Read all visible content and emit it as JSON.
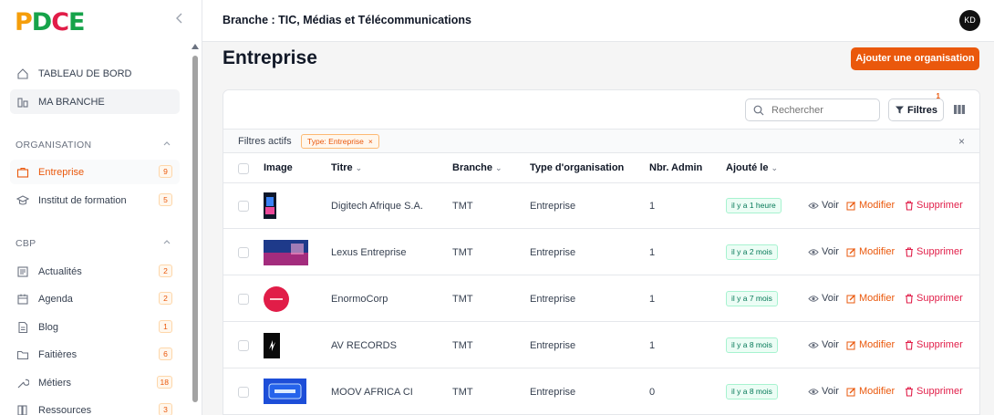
{
  "brand": {
    "logo_text": "PDCE"
  },
  "sidebar": {
    "top_items": [
      {
        "label": "TABLEAU DE BORD",
        "icon": "home-icon"
      },
      {
        "label": "MA BRANCHE",
        "icon": "branch-icon"
      }
    ],
    "sections": [
      {
        "title": "ORGANISATION",
        "items": [
          {
            "label": "Entreprise",
            "count": "9",
            "icon": "briefcase-icon"
          },
          {
            "label": "Institut de formation",
            "count": "5",
            "icon": "graduation-cap-icon"
          }
        ]
      },
      {
        "title": "CBP",
        "items": [
          {
            "label": "Actualités",
            "count": "2",
            "icon": "newspaper-icon"
          },
          {
            "label": "Agenda",
            "count": "2",
            "icon": "calendar-icon"
          },
          {
            "label": "Blog",
            "count": "1",
            "icon": "document-icon"
          },
          {
            "label": "Faitières",
            "count": "6",
            "icon": "folder-icon"
          },
          {
            "label": "Métiers",
            "count": "18",
            "icon": "tools-icon"
          },
          {
            "label": "Ressources",
            "count": "3",
            "icon": "resources-icon"
          }
        ]
      }
    ]
  },
  "header": {
    "branch_title": "Branche : TIC, Médias et Télécommunications",
    "avatar_initials": "KD"
  },
  "main": {
    "title": "Entreprise",
    "add_button": "Ajouter une organisation",
    "search_placeholder": "Rechercher",
    "filters_label": "Filtres",
    "filters_count": "1",
    "active_filters_label": "Filtres actifs",
    "active_filter_chip": "Type: Entreprise",
    "chip_close": "×",
    "clear_close": "×"
  },
  "table": {
    "columns": [
      "Image",
      "Titre",
      "Branche",
      "Type d'organisation",
      "Nbr. Admin",
      "Ajouté le"
    ],
    "action_labels": {
      "view": "Voir",
      "edit": "Modifier",
      "delete": "Supprimer"
    },
    "rows": [
      {
        "title": "Digitech Afrique S.A.",
        "branch": "TMT",
        "type": "Entreprise",
        "admins": "1",
        "added": "il y a 1 heure"
      },
      {
        "title": "Lexus Entreprise",
        "branch": "TMT",
        "type": "Entreprise",
        "admins": "1",
        "added": "il y a 2 mois"
      },
      {
        "title": "EnormoCorp",
        "branch": "TMT",
        "type": "Entreprise",
        "admins": "1",
        "added": "il y a 7 mois"
      },
      {
        "title": "AV RECORDS",
        "branch": "TMT",
        "type": "Entreprise",
        "admins": "1",
        "added": "il y a 8 mois"
      },
      {
        "title": "MOOV AFRICA CI",
        "branch": "TMT",
        "type": "Entreprise",
        "admins": "0",
        "added": "il y a 8 mois"
      }
    ]
  },
  "colors": {
    "accent": "#ea580c",
    "success": "#047857",
    "danger": "#e11d48"
  }
}
